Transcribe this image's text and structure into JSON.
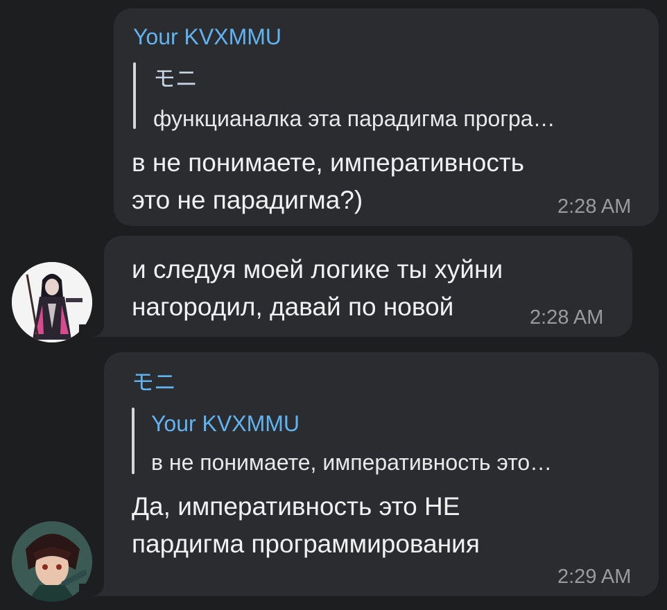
{
  "messages": [
    {
      "sender": "Your KVXMMU",
      "reply": {
        "name": "モニ",
        "text": "функцианалка эта парадигма програ…"
      },
      "text": "в не понимаете, императивность\nэто не парадигма?)",
      "time": "2:28 AM"
    },
    {
      "text": "и следуя моей логике ты хуйни\nнагородил, давай по новой",
      "time": "2:28 AM",
      "avatar": "anime-girl-avatar"
    },
    {
      "sender": "モニ",
      "reply": {
        "name": "Your KVXMMU",
        "text": "в не понимаете, императивность это…"
      },
      "text": "Да, императивность это НЕ\nпардигма программирования",
      "time": "2:29 AM",
      "avatar": "anime-boy-avatar"
    }
  ],
  "colors": {
    "background": "#1d1e20",
    "bubble": "#2b2c30",
    "sender_name": "#62b4f0",
    "reply_name_1": "#c9d6e6",
    "reply_name_2": "#62b4f0",
    "time": "#9a9ba0"
  }
}
